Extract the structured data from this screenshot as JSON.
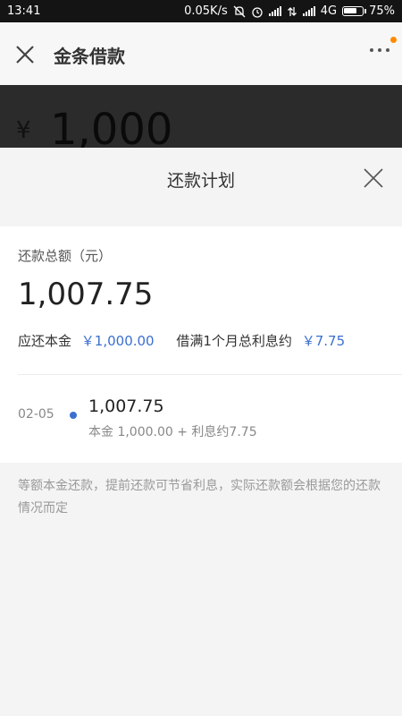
{
  "status_bar": {
    "time": "13:41",
    "net_speed": "0.05K/s",
    "network": "4G",
    "battery": "75%",
    "battery_level": 0.75
  },
  "header": {
    "title": "金条借款",
    "close_icon": "close-icon",
    "more_icon": "more-icon",
    "notification_color": "#ff8a00"
  },
  "loan": {
    "currency": "¥",
    "amount": "1,000"
  },
  "sheet": {
    "title": "还款计划",
    "total_label": "还款总额（元）",
    "total_value": "1,007.75",
    "principal_label": "应还本金",
    "principal_value": "￥1,000.00",
    "interest_label": "借满1个月总利息约",
    "interest_value": "￥7.75",
    "accent_color": "#3b6fd0"
  },
  "plan": [
    {
      "date": "02-05",
      "amount": "1,007.75",
      "detail": "本金 1,000.00 + 利息约7.75"
    }
  ],
  "note": "等额本金还款，提前还款可节省利息，实际还款额会根据您的还款情况而定"
}
